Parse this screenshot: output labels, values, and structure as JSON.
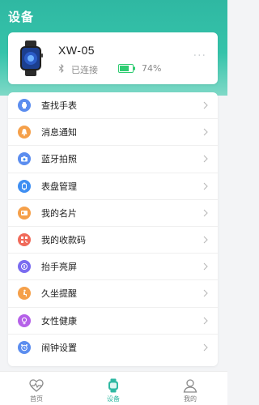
{
  "header": {
    "title": "设备"
  },
  "device": {
    "name": "XW-05",
    "connection_status": "已连接",
    "battery": "74%",
    "battery_fraction": 0.74,
    "more_label": "···"
  },
  "menu": {
    "items": [
      {
        "label": "查找手表",
        "icon": "watch-icon",
        "color": "#5b8def"
      },
      {
        "label": "消息通知",
        "icon": "bell-icon",
        "color": "#f5a04a"
      },
      {
        "label": "蓝牙拍照",
        "icon": "camera-icon",
        "color": "#5b8def"
      },
      {
        "label": "表盘管理",
        "icon": "watch-face-icon",
        "color": "#3f8ff2"
      },
      {
        "label": "我的名片",
        "icon": "card-icon",
        "color": "#f5a04a"
      },
      {
        "label": "我的收款码",
        "icon": "qr-code-icon",
        "color": "#f06a5a"
      },
      {
        "label": "抬手亮屏",
        "icon": "raise-wrist-icon",
        "color": "#7a6cf0"
      },
      {
        "label": "久坐提醒",
        "icon": "sedentary-icon",
        "color": "#f5a04a"
      },
      {
        "label": "女性健康",
        "icon": "female-health-icon",
        "color": "#b561e8"
      },
      {
        "label": "闹钟设置",
        "icon": "alarm-clock-icon",
        "color": "#5b8def"
      }
    ]
  },
  "tabbar": {
    "tabs": [
      {
        "label": "首页",
        "icon": "heart-pulse-icon",
        "active": false
      },
      {
        "label": "设备",
        "icon": "watch-icon",
        "active": true
      },
      {
        "label": "我的",
        "icon": "user-icon",
        "active": false
      }
    ]
  },
  "colors": {
    "accent": "#2fb8a2",
    "battery": "#2ecc71"
  }
}
